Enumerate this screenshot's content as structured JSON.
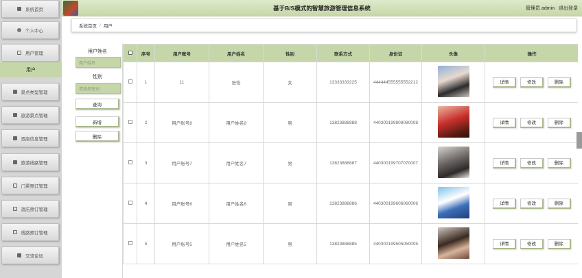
{
  "header": {
    "title": "基于B/S模式的智慧旅游管理信息系统",
    "user": "管理员 admin",
    "logout": "退出登录"
  },
  "sidebar": {
    "items": [
      {
        "label": "系统首页",
        "icon": "home-icon"
      },
      {
        "label": "个人中心",
        "icon": "person-icon"
      },
      {
        "label": "用户管理",
        "icon": "sliders-icon"
      },
      {
        "label": "景点类型管理",
        "icon": "monitor-icon"
      },
      {
        "label": "旅游景点管理",
        "icon": "picture-icon"
      },
      {
        "label": "酒店信息管理",
        "icon": "monitor-icon"
      },
      {
        "label": "旅游线路管理",
        "icon": "chart-icon"
      },
      {
        "label": "门票预订管理",
        "icon": "grid-icon"
      },
      {
        "label": "酒店预订管理",
        "icon": "grid-icon"
      },
      {
        "label": "线路预订管理",
        "icon": "grid-icon"
      },
      {
        "label": "交流论坛",
        "icon": "home-icon"
      }
    ],
    "sub_item": "用户"
  },
  "breadcrumb": {
    "home": "系统首页",
    "sep": "/",
    "current": "用户"
  },
  "search": {
    "name_label": "用户姓名",
    "name_placeholder": "用户姓名",
    "gender_label": "性别",
    "gender_placeholder": "请选择性别",
    "query_btn": "查询",
    "add_btn": "新增",
    "delete_btn": "删除"
  },
  "table": {
    "headers": [
      "序号",
      "用户账号",
      "用户姓名",
      "性别",
      "联系方式",
      "身份证",
      "头像",
      "操作"
    ],
    "rows": [
      {
        "index": "1",
        "account": "11",
        "name": "张怡",
        "gender": "女",
        "phone": "13333333225",
        "id_card": "444444555555552212"
      },
      {
        "index": "2",
        "account": "用户账号8",
        "name": "用户姓名8",
        "gender": "男",
        "phone": "13823888888",
        "id_card": "440300199808080008"
      },
      {
        "index": "3",
        "account": "用户账号7",
        "name": "用户姓名7",
        "gender": "男",
        "phone": "13823888887",
        "id_card": "440300199707070007"
      },
      {
        "index": "4",
        "account": "用户账号6",
        "name": "用户姓名6",
        "gender": "男",
        "phone": "13823888886",
        "id_card": "440300199606060006"
      },
      {
        "index": "5",
        "account": "用户账号5",
        "name": "用户姓名5",
        "gender": "男",
        "phone": "13823888885",
        "id_card": "440300199505050005"
      }
    ],
    "ops": {
      "detail": "详情",
      "edit": "修改",
      "delete": "删除"
    }
  },
  "colors": {
    "accent": "#c5d7a8",
    "sidebar_bg": "#d6d6d6"
  }
}
